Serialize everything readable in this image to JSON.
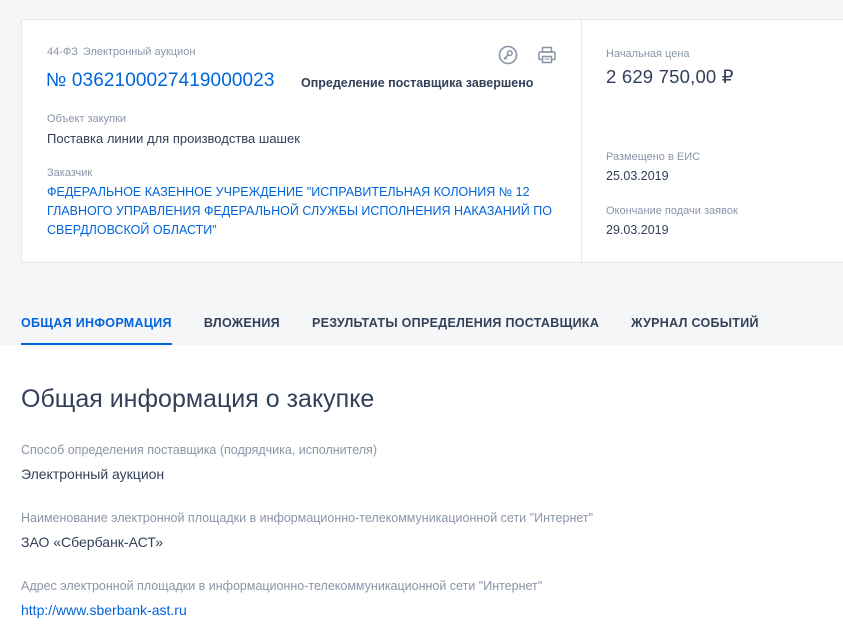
{
  "card": {
    "law": "44-ФЗ",
    "procedure_type": "Электронный аукцион",
    "number": "№ 0362100027419000023",
    "status": "Определение поставщика завершено",
    "subject_label": "Объект закупки",
    "subject_value": "Поставка линии для производства шашек",
    "customer_label": "Заказчик",
    "customer_value": "ФЕДЕРАЛЬНОЕ КАЗЕННОЕ УЧРЕЖДЕНИЕ \"ИСПРАВИТЕЛЬНАЯ КОЛОНИЯ № 12 ГЛАВНОГО УПРАВЛЕНИЯ ФЕДЕРАЛЬНОЙ СЛУЖБЫ ИСПОЛНЕНИЯ НАКАЗАНИЙ ПО СВЕРДЛОВСКОЙ ОБЛАСТИ\"",
    "price_label": "Начальная цена",
    "price_value": "2 629 750,00 ₽",
    "posted_label": "Размещено в ЕИС",
    "posted_value": "25.03.2019",
    "deadline_label": "Окончание подачи заявок",
    "deadline_value": "29.03.2019"
  },
  "icons": {
    "key": "key-icon",
    "print": "print-icon"
  },
  "tabs": [
    {
      "label": "ОБЩАЯ ИНФОРМАЦИЯ",
      "active": true
    },
    {
      "label": "ВЛОЖЕНИЯ",
      "active": false
    },
    {
      "label": "РЕЗУЛЬТАТЫ ОПРЕДЕЛЕНИЯ ПОСТАВЩИКА",
      "active": false
    },
    {
      "label": "ЖУРНАЛ СОБЫТИЙ",
      "active": false
    }
  ],
  "section": {
    "title": "Общая информация о закупке",
    "fields": [
      {
        "label": "Способ определения поставщика (подрядчика, исполнителя)",
        "value": "Электронный аукцион"
      },
      {
        "label": "Наименование электронной площадки в информационно-телекоммуникационной сети \"Интернет\"",
        "value": "ЗАО «Сбербанк-АСТ»"
      },
      {
        "label": "Адрес электронной площадки в информационно-телекоммуникационной сети \"Интернет\"",
        "value": "http://www.sberbank-ast.ru"
      }
    ]
  },
  "colors": {
    "accent": "#0065dd",
    "text": "#334059",
    "muted": "#8a95a8",
    "background": "#f5f6f8"
  }
}
